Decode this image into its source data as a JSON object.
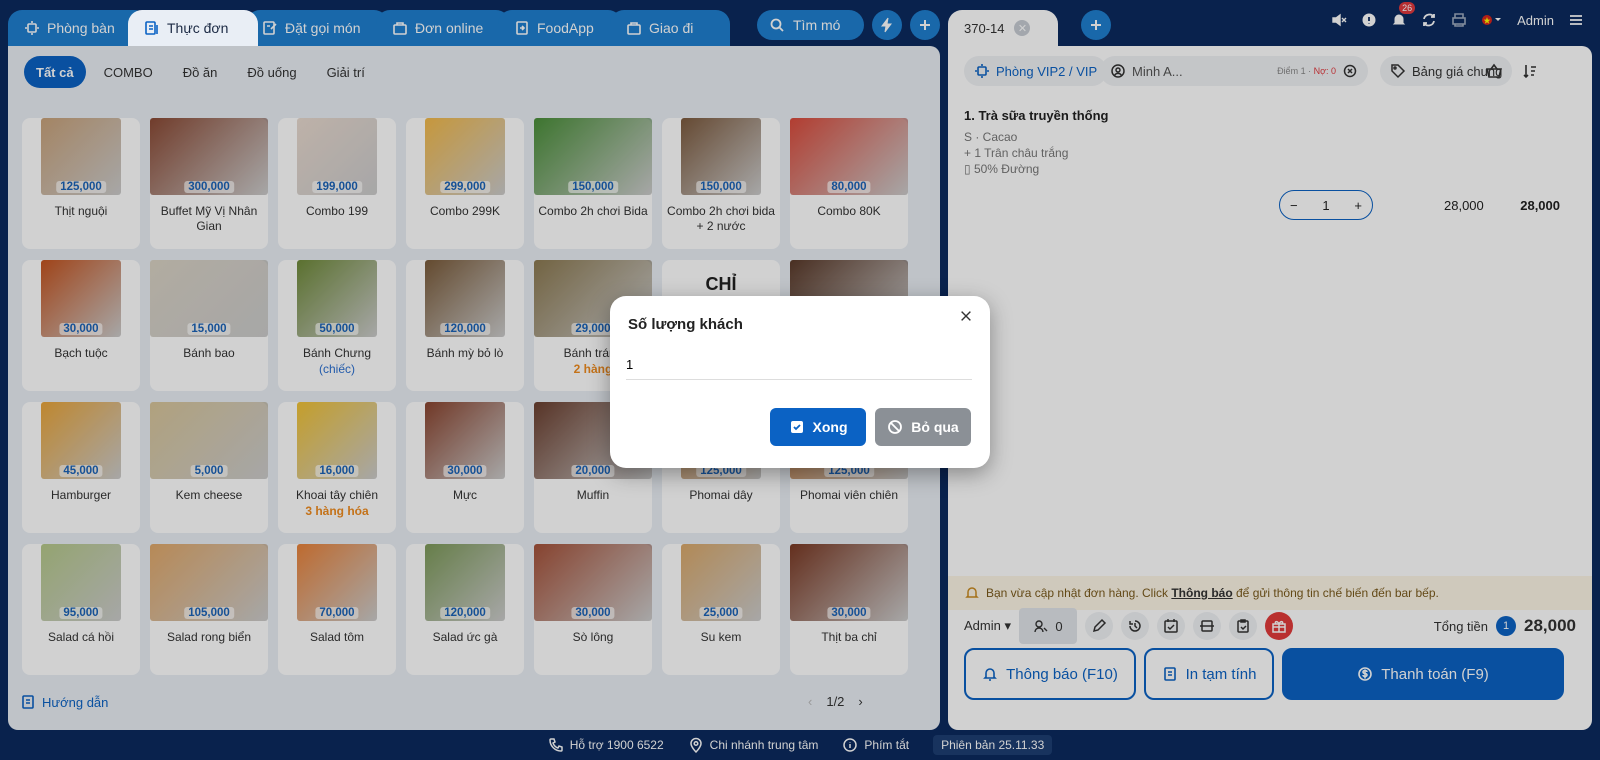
{
  "app": {
    "tabs": [
      {
        "label": "Phòng bàn",
        "icon": "table-icon"
      },
      {
        "label": "Thực đơn",
        "icon": "menu-icon",
        "active": true
      },
      {
        "label": "Đặt gọi món",
        "icon": "order-icon"
      },
      {
        "label": "Đơn online",
        "icon": "bag-icon"
      },
      {
        "label": "FoodApp",
        "icon": "app-icon"
      },
      {
        "label": "Giao đi",
        "icon": "delivery-icon"
      }
    ],
    "search_label": "Tìm mó"
  },
  "categories": [
    "Tất cả",
    "COMBO",
    "Đồ ăn",
    "Đồ uống",
    "Giải trí"
  ],
  "products": [
    {
      "name": "Thịt nguội",
      "price": "125,000",
      "color": "#c9a27a"
    },
    {
      "name": "Buffet Mỹ Vị Nhân Gian",
      "price": "300,000",
      "color": "#8a4a35"
    },
    {
      "name": "Combo 199",
      "price": "199,000",
      "color": "#e8d9cf"
    },
    {
      "name": "Combo 299K",
      "price": "299,000",
      "color": "#f2b94a"
    },
    {
      "name": "Combo 2h chơi Bida",
      "price": "150,000",
      "color": "#4b8f3a"
    },
    {
      "name": "Combo 2h chơi bida + 2 nước",
      "price": "150,000",
      "color": "#7c5a3e"
    },
    {
      "name": "Combo 80K",
      "price": "80,000",
      "color": "#d94b3c"
    },
    {
      "name": "Bạch tuộc",
      "price": "30,000",
      "color": "#c3531f"
    },
    {
      "name": "Bánh bao",
      "price": "15,000",
      "color": "#d9d2c4"
    },
    {
      "name": "Bánh Chưng",
      "price": "50,000",
      "sub": "(chiếc)",
      "sub_class": "blue",
      "color": "#6f8a3a"
    },
    {
      "name": "Bánh mỳ bỏ lò",
      "price": "120,000",
      "color": "#7a5b3a"
    },
    {
      "name": "Bánh tráng",
      "price": "29,000",
      "sub": "2 hàng",
      "sub_class": "orange",
      "color": "#8c7a52"
    },
    {
      "name": "",
      "price": "",
      "overlay": "CHỈ",
      "color": "#ffffff"
    },
    {
      "name": "",
      "price": "",
      "color": "#5a3a2a"
    },
    {
      "name": "Hamburger",
      "price": "45,000",
      "color": "#e9a53a"
    },
    {
      "name": "Kem cheese",
      "price": "5,000",
      "color": "#d8c59a"
    },
    {
      "name": "Khoai tây chiên",
      "price": "16,000",
      "sub": "3 hàng hóa",
      "sub_class": "orange",
      "color": "#f0c235"
    },
    {
      "name": "Mực",
      "price": "30,000",
      "color": "#8a4530"
    },
    {
      "name": "Muffin",
      "price": "20,000",
      "color": "#6b4030"
    },
    {
      "name": "Phomai dây",
      "price": "125,000",
      "color": "#c98b4a"
    },
    {
      "name": "Phomai viên chiên",
      "price": "125,000",
      "color": "#c47a3a"
    },
    {
      "name": "Salad cá hồi",
      "price": "95,000",
      "color": "#b5c98a"
    },
    {
      "name": "Salad rong biển",
      "price": "105,000",
      "color": "#e0a86a"
    },
    {
      "name": "Salad tôm",
      "price": "70,000",
      "color": "#e8823a"
    },
    {
      "name": "Salad ức gà",
      "price": "120,000",
      "color": "#7d9a5a"
    },
    {
      "name": "Sò lông",
      "price": "30,000",
      "color": "#a5523a"
    },
    {
      "name": "Su kem",
      "price": "25,000",
      "color": "#d9a86a"
    },
    {
      "name": "Thịt ba chỉ",
      "price": "30,000",
      "color": "#7a3a25"
    }
  ],
  "guide_label": "Hướng dẫn",
  "pager": {
    "text": "1/2"
  },
  "order": {
    "tab_label": "370-14",
    "room": "Phòng VIP2 / VIP",
    "customer": "Minh A...",
    "points": "Điểm 1 · ",
    "debt": "Nợ: 0",
    "price_list": "Bảng giá chung",
    "item": {
      "title": "1. Trà sữa truyền thống",
      "size": "S · Cacao",
      "topping": "+ 1 Trân châu trắng",
      "note": "50% Đường",
      "qty": "1",
      "unit_price": "28,000",
      "line_total": "28,000"
    },
    "notice_prefix": "Bạn vừa cập nhật đơn hàng. Click ",
    "notice_link": "Thông báo",
    "notice_suffix": " để gửi thông tin chế biến đến bar bếp.",
    "staff": "Admin",
    "guest_count": "0",
    "total_label": "Tổng tiền",
    "total_items": "1",
    "total": "28,000",
    "notify_btn": "Thông báo (F10)",
    "print_btn": "In tạm tính",
    "pay_btn": "Thanh toán (F9)"
  },
  "topbar": {
    "user": "Admin",
    "notif_count": "26"
  },
  "footer": {
    "support": "Hỗ trợ 1900 6522",
    "branch": "Chi nhánh trung tâm",
    "shortcuts": "Phím tắt",
    "version": "Phiên bản 25.11.33"
  },
  "modal": {
    "title": "Số lượng khách",
    "value": "1",
    "ok": "Xong",
    "skip": "Bỏ qua"
  }
}
